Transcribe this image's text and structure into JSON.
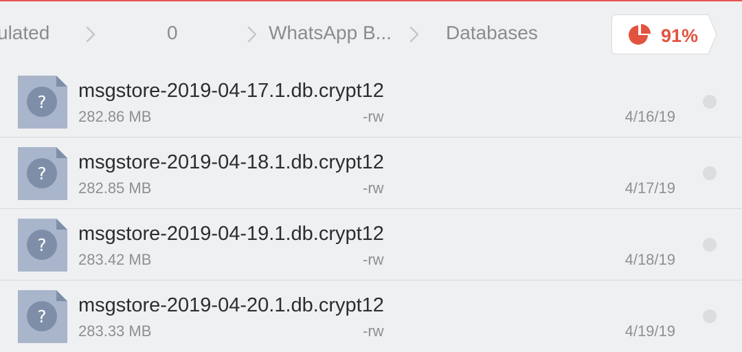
{
  "breadcrumbs": [
    {
      "label": "ulated"
    },
    {
      "label": "0"
    },
    {
      "label": "WhatsApp B..."
    },
    {
      "label": "Databases"
    }
  ],
  "storage": {
    "percent_text": "91%",
    "icon": "pie-chart-icon",
    "color": "#e2533f"
  },
  "files": [
    {
      "name": "msgstore-2019-04-17.1.db.crypt12",
      "size": "282.86 MB",
      "perm": "-rw",
      "date": "4/16/19",
      "icon": "unknown-file-icon"
    },
    {
      "name": "msgstore-2019-04-18.1.db.crypt12",
      "size": "282.85 MB",
      "perm": "-rw",
      "date": "4/17/19",
      "icon": "unknown-file-icon"
    },
    {
      "name": "msgstore-2019-04-19.1.db.crypt12",
      "size": "283.42 MB",
      "perm": "-rw",
      "date": "4/18/19",
      "icon": "unknown-file-icon"
    },
    {
      "name": "msgstore-2019-04-20.1.db.crypt12",
      "size": "283.33 MB",
      "perm": "-rw",
      "date": "4/19/19",
      "icon": "unknown-file-icon"
    }
  ]
}
